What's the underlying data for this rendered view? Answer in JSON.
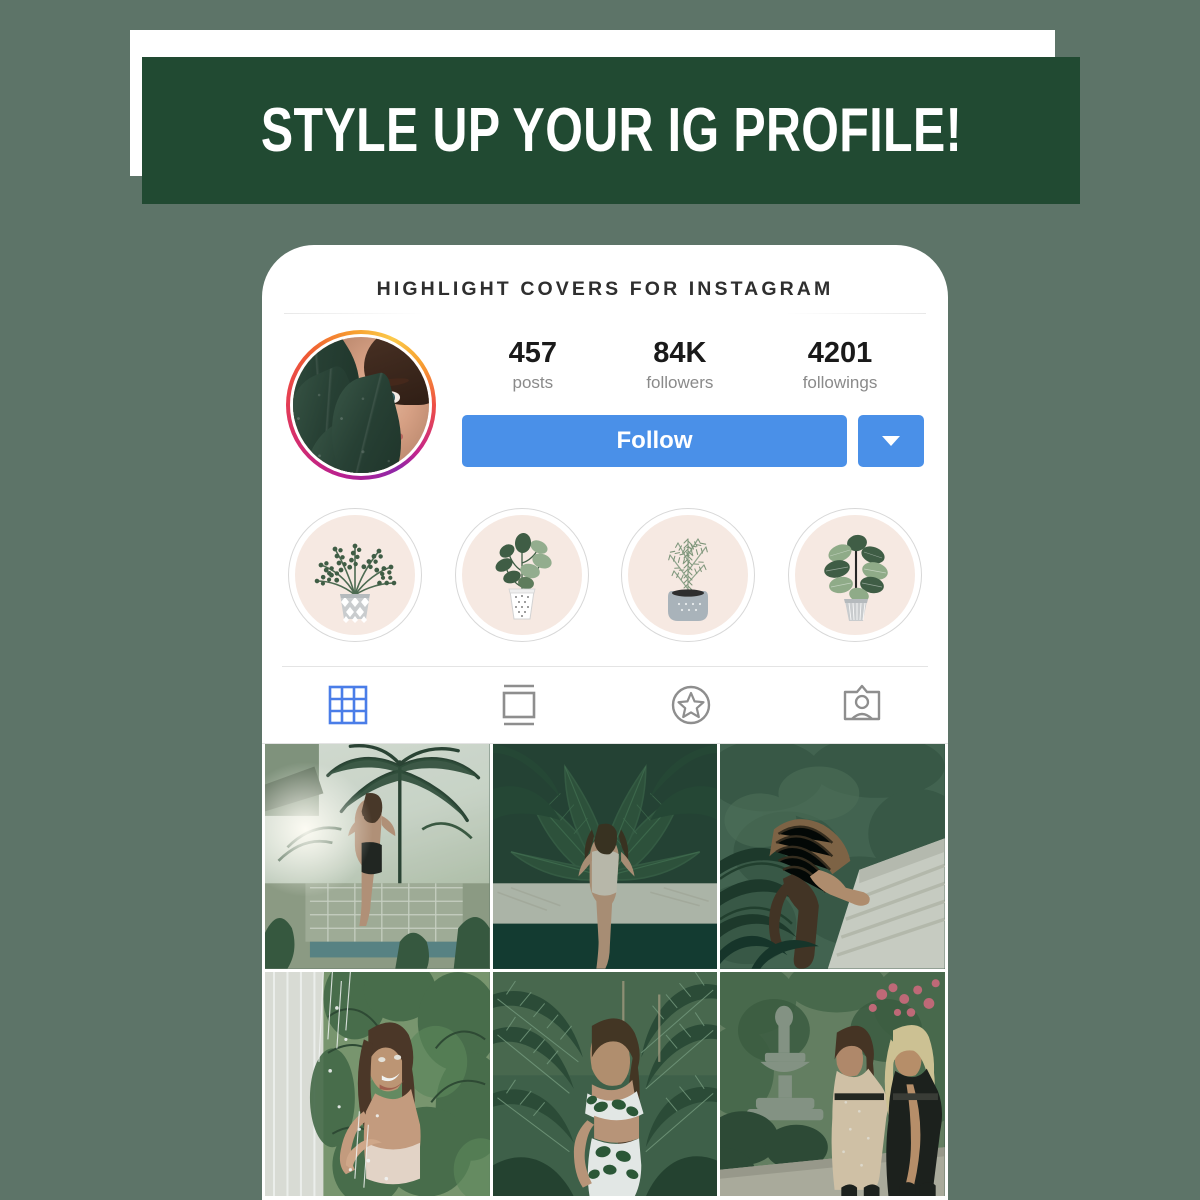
{
  "banner": {
    "title": "STYLE UP YOUR IG PROFILE!",
    "bg_color": "#214a32",
    "frame_color": "#ffffff",
    "text_color": "#ffffff"
  },
  "page": {
    "background_color": "#5d7468"
  },
  "phone": {
    "header_title": "HIGHLIGHT COVERS FOR INSTAGRAM",
    "profile": {
      "avatar_alt": "profile-photo-woman-with-leaves",
      "avatar_ring": "instagram-gradient",
      "stats": [
        {
          "value": "457",
          "label": "posts"
        },
        {
          "value": "84K",
          "label": "followers"
        },
        {
          "value": "4201",
          "label": "followings"
        }
      ],
      "follow_label": "Follow",
      "follow_color": "#4a90e8",
      "dropdown_icon": "caret-down-icon"
    },
    "highlights": [
      {
        "name": "fern-plant-cover",
        "icon": "fern-in-patterned-pot",
        "bg": "#f6e9e2"
      },
      {
        "name": "pothos-plant-cover",
        "icon": "pothos-in-dotted-pot",
        "bg": "#f6e9e2"
      },
      {
        "name": "rosemary-plant-cover",
        "icon": "rosemary-in-grey-basket",
        "bg": "#f6e9e2"
      },
      {
        "name": "rubber-plant-cover",
        "icon": "rubber-plant-in-pot",
        "bg": "#f6e9e2"
      }
    ],
    "tabs": [
      {
        "name": "tab-grid",
        "icon": "grid-icon",
        "active": true,
        "color": "#4a7de8"
      },
      {
        "name": "tab-feed",
        "icon": "feed-list-icon",
        "active": false,
        "color": "#8e8e8e"
      },
      {
        "name": "tab-igtv",
        "icon": "star-circle-icon",
        "active": false,
        "color": "#8e8e8e"
      },
      {
        "name": "tab-tagged",
        "icon": "person-card-icon",
        "active": false,
        "color": "#8e8e8e"
      }
    ],
    "photos": [
      {
        "name": "photo-palm-sunset-pool",
        "alt": "woman standing by pool with palm trees at sunset"
      },
      {
        "name": "photo-palm-fronds-pool",
        "alt": "woman in beige swimsuit before large palm leaves"
      },
      {
        "name": "photo-green-balcony",
        "alt": "woman on balcony in striped top among foliage"
      },
      {
        "name": "photo-shower-garden",
        "alt": "woman in outdoor shower in tropical garden"
      },
      {
        "name": "photo-palm-leaf-bikini",
        "alt": "woman in leaf-print bikini behind palm frond"
      },
      {
        "name": "photo-fountain-gowns",
        "alt": "two women in gowns by a garden fountain"
      }
    ]
  }
}
